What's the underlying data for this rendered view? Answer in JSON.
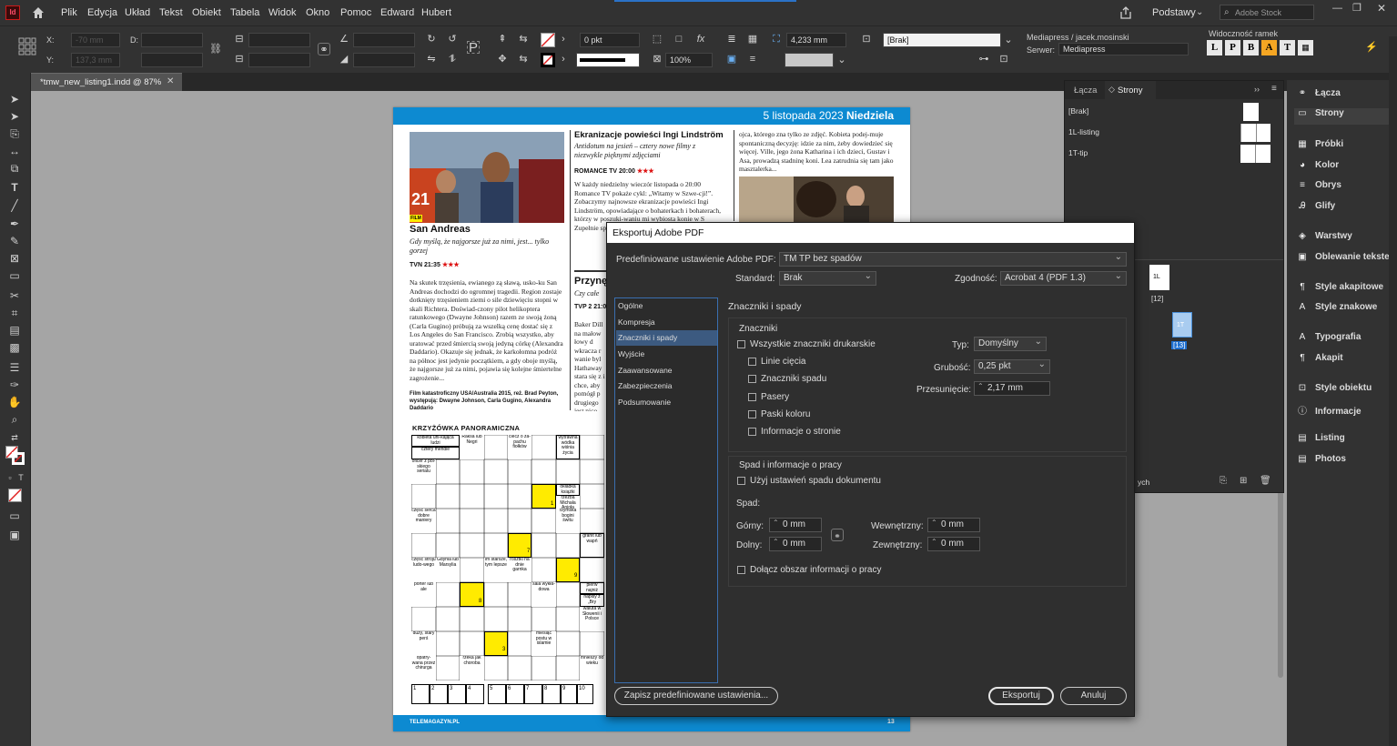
{
  "app": {
    "logo": "Id",
    "menu": [
      "Plik",
      "Edycja",
      "Układ",
      "Tekst",
      "Obiekt",
      "Tabela",
      "Widok",
      "Okno",
      "Pomoc",
      "Edward",
      "Hubert"
    ],
    "workspace": "Podstawy",
    "search_placeholder": "Adobe Stock"
  },
  "control": {
    "x_label": "X:",
    "y_label": "Y:",
    "x_value": "-70 mm",
    "y_value": "137,3 mm",
    "d_label": "D:",
    "stroke_weight": "0 pkt",
    "zoom_pct": "100%",
    "width_mm": "4,233 mm",
    "style": "[Brak]",
    "mediapress_user": "Mediapress / jacek.mosinski",
    "server_label": "Serwer:",
    "server_value": "Mediapress",
    "frame_visibility_label": "Widoczność ramek",
    "frame_buttons": [
      "L",
      "P",
      "B",
      "A",
      "T",
      ""
    ]
  },
  "document": {
    "tab": "*tmw_new_listing1.indd @ 87%",
    "date": "5 listopada 2023",
    "day": "Niedziela",
    "film_tag": "FILM",
    "article1_title": "San Andreas",
    "article1_lead": "Gdy myślą, że najgorsze już za nimi, jest... tylko gorzej",
    "article1_channel": "TVN 21:35",
    "article1_body": "Na skutek trzęsienia, ewianego zą sławą, usko-ku San Andreas dochodzi do ogromnej tragedii. Region zostaje dotknięty trzęsieniem ziemi o sile dziewięciu stopni w skali Richtera. Doświad-czony pilot helikoptera ratunkowego (Dwayne Johnson) razem ze swoją żoną (Carla Gugino) próbują za wszelką cenę dostać się z Los Angeles do San Francisco. Zrobią wszystko, aby uratować przed śmiercią swoją jedyną córkę (Alexandra Daddario). Okazuje się jednak, że karkołomna podróż na północ jest jedynie początkiem, a gdy oboje myślą, że najgorsze już za nimi, pojawia się kolejne śmiertelne zagrożenie...",
    "article1_credits": "Film katastroficzny USA/Australia 2015, reż. Brad Peyton, występują: Dwayne Johnson, Carla Gugino, Alexandra Daddario",
    "article2_title": "Ekranizacje powieści Ingi Lindström",
    "article2_lead": "Antidotum na jesień – cztery nowe filmy z niezwykle pięknymi zdjęciami",
    "article2_channel": "ROMANCE TV 20:00",
    "article2_body": "W każdy niedzielny wieczór listopada o 20:00 Romance TV pokaże cykl: „Witamy w Szwe-cji!”. Zobaczymy najnowsze ekranizacje powieści Ingi Lindström, opowiadające o bohaterkach i bohaterach, którzy w poszuki-waniu mi wybiosta konie w S Zupełnie spotyka m",
    "article3_title": "Przynę",
    "article3_lead": "Czy całe",
    "article3_channel": "TVP 2 21:00",
    "article3_body": "Baker Dill na małow łowy d wkracza r wanie byl Hathaway stara się z i chce, aby pomógł p drugiego jest nico",
    "article4_body": "ojca, którego zna tylko ze zdjęć. Kobieta podej-muje spontaniczną decyzję: idzie za nim, żeby dowiedzieć się więcej. Ville, jego żona Katharina i ich dzieci, Gustav i Asa, prowadzą stadninę koni. Lea zatrudnia się tam jako masztalerka...",
    "crossword_title": "KRZYŻÓWKA PANORAMICZNA",
    "footer_left": "TELEMAGAZYN.PL",
    "footer_right": "13",
    "crossword_numbers": [
      "1",
      "2",
      "3",
      "4",
      "5",
      "6",
      "7",
      "8",
      "9",
      "10"
    ]
  },
  "crossword_clues": [
    "kobieta uni-kająca ludzi",
    "cztery mendle",
    "Raksa lub Negri",
    "ciecz o za-pachu fiołków",
    "wytrawna wódka wiśnia życia",
    "oficer z pol-skiego serialu",
    "część serca dobre maniery",
    "okładka książki",
    "rzeźba Michała Anioła",
    "rzymska bogini świtu",
    "granit lub wapń",
    "część stroju ludo-wego",
    "Gdynia lub Marsylia",
    "im starsze, tym lepsze",
    "rosztki na dnie garnka",
    "sala wykła-dowa",
    "porter lub ale",
    "pierw najniż",
    "napisy z „Bry",
    "waluta w Słowenii i Polsce",
    "duży, stary perś",
    "miesiąc postu w islamie",
    "opatry-wana przez chirurga",
    "rzeka jak choroba",
    "mnieszy od wieku"
  ],
  "crossword_marks": [
    "1",
    "7",
    "8",
    "9",
    "3"
  ],
  "pages_panel": {
    "tabs": [
      "Łącza",
      "Strony"
    ],
    "masters": [
      "[Brak]",
      "1L-listing",
      "1T-tip"
    ],
    "page_labels": [
      "1L",
      "[12]",
      "1T",
      "[13]"
    ],
    "footer_text": "ych"
  },
  "right_panel": {
    "items": [
      "Łącza",
      "Strony",
      "Próbki",
      "Kolor",
      "Obrys",
      "Glify",
      "Warstwy",
      "Oblewanie tekstem",
      "Style akapitowe",
      "Style znakowe",
      "Typografia",
      "Akapit",
      "Style obiektu",
      "Informacje",
      "Listing",
      "Photos"
    ]
  },
  "dialog": {
    "title": "Eksportuj Adobe PDF",
    "preset_label": "Predefiniowane ustawienie Adobe PDF:",
    "preset_value": "TM TP bez spadów",
    "standard_label": "Standard:",
    "standard_value": "Brak",
    "compat_label": "Zgodność:",
    "compat_value": "Acrobat 4 (PDF 1.3)",
    "categories": [
      "Ogólne",
      "Kompresja",
      "Znaczniki i spady",
      "Wyjście",
      "Zaawansowane",
      "Zabezpieczenia",
      "Podsumowanie"
    ],
    "section_title": "Znaczniki i spady",
    "marks_title": "Znaczniki",
    "all_marks": "Wszystkie znaczniki drukarskie",
    "marks": [
      "Linie cięcia",
      "Znaczniki spadu",
      "Pasery",
      "Paski koloru",
      "Informacje o stronie"
    ],
    "type_label": "Typ:",
    "type_value": "Domyślny",
    "weight_label": "Grubość:",
    "weight_value": "0,25 pkt",
    "offset_label": "Przesunięcie:",
    "offset_value": "2,17 mm",
    "bleed_title": "Spad i informacje o pracy",
    "use_doc_bleed": "Użyj ustawień spadu dokumentu",
    "bleed_label": "Spad:",
    "top_label": "Górny:",
    "top_value": "0 mm",
    "bottom_label": "Dolny:",
    "bottom_value": "0 mm",
    "inside_label": "Wewnętrzny:",
    "inside_value": "0 mm",
    "outside_label": "Zewnętrzny:",
    "outside_value": "0 mm",
    "slug_label": "Dołącz obszar informacji o pracy",
    "save_preset": "Zapisz predefiniowane ustawienia...",
    "export": "Eksportuj",
    "cancel": "Anuluj"
  },
  "colors": {
    "accent": "#0a84d6",
    "header_blue": "#0d8ad1",
    "rating_red": "#d11",
    "yellow": "#ffeb00",
    "app_logo": "#cc1a1a"
  }
}
